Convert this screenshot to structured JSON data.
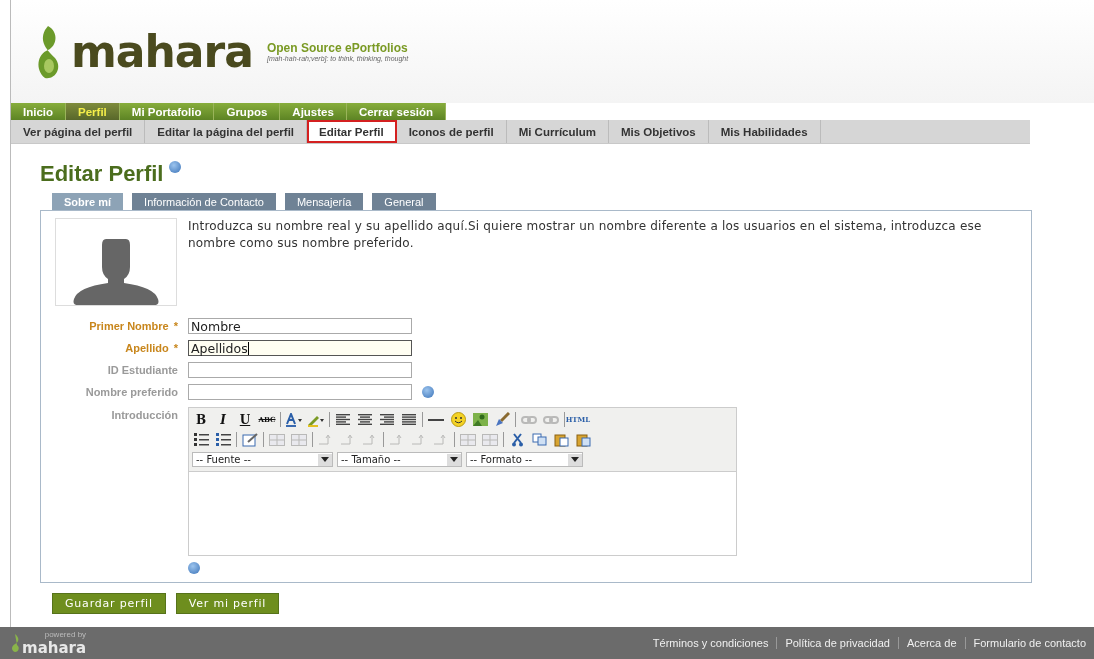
{
  "header": {
    "logo_text": "mahara",
    "tagline": "Open Source ePortfolios",
    "subtitle": "[mah-hah-rah;verb]: to think, thinking, thought"
  },
  "main_nav": [
    {
      "label": "Inicio",
      "selected": false
    },
    {
      "label": "Perfil",
      "selected": true
    },
    {
      "label": "Mi Portafolio",
      "selected": false
    },
    {
      "label": "Grupos",
      "selected": false
    },
    {
      "label": "Ajustes",
      "selected": false
    },
    {
      "label": "Cerrar sesión",
      "selected": false
    }
  ],
  "sub_nav": [
    {
      "label": "Ver página del perfil",
      "selected": false
    },
    {
      "label": "Editar la página del perfil",
      "selected": false
    },
    {
      "label": "Editar Perfil",
      "selected": true
    },
    {
      "label": "Iconos de perfil",
      "selected": false
    },
    {
      "label": "Mi Currículum",
      "selected": false
    },
    {
      "label": "Mis Objetivos",
      "selected": false
    },
    {
      "label": "Mis Habilidades",
      "selected": false
    }
  ],
  "page_title": "Editar Perfil",
  "tabs": [
    {
      "label": "Sobre mí",
      "selected": true
    },
    {
      "label": "Información de Contacto",
      "selected": false
    },
    {
      "label": "Mensajería",
      "selected": false
    },
    {
      "label": "General",
      "selected": false
    }
  ],
  "intro_text": "Introduzca su nombre real y su apellido aquí.Si quiere mostrar un nombre diferente a los usuarios en el sistema, introduzca ese nombre como sus nombre preferido.",
  "fields": [
    {
      "label": "Primer Nombre",
      "required": true,
      "mark": "*",
      "value": "Nombre",
      "focused": false,
      "help": false
    },
    {
      "label": "Apellido",
      "required": true,
      "mark": "*",
      "value": "Apellidos",
      "focused": true,
      "help": false
    },
    {
      "label": "ID Estudiante",
      "required": false,
      "focused": false,
      "help": false
    },
    {
      "label": "Nombre preferido",
      "required": false,
      "focused": false,
      "help": true
    }
  ],
  "editor": {
    "label": "Introducción",
    "toolbar_rows": [
      [
        {
          "kind": "bold",
          "label": "B",
          "disabled": false
        },
        {
          "kind": "italic",
          "label": "I",
          "disabled": false
        },
        {
          "kind": "underline",
          "label": "U",
          "disabled": false
        },
        {
          "kind": "strike",
          "label": "ABC",
          "disabled": false
        },
        {
          "kind": "sep"
        },
        {
          "kind": "fontcolor",
          "disabled": false
        },
        {
          "kind": "highlight",
          "disabled": false
        },
        {
          "kind": "sep"
        },
        {
          "kind": "alignleft",
          "disabled": false
        },
        {
          "kind": "aligncenter",
          "disabled": false
        },
        {
          "kind": "alignright",
          "disabled": false
        },
        {
          "kind": "justify",
          "disabled": false
        },
        {
          "kind": "sep"
        },
        {
          "kind": "hr",
          "disabled": false
        },
        {
          "kind": "smiley",
          "disabled": false
        },
        {
          "kind": "image",
          "disabled": false
        },
        {
          "kind": "brush",
          "disabled": false
        },
        {
          "kind": "sep"
        },
        {
          "kind": "link",
          "disabled": true
        },
        {
          "kind": "unlink",
          "disabled": true
        },
        {
          "kind": "sep"
        },
        {
          "kind": "html",
          "label": "HTML",
          "disabled": false
        }
      ],
      [
        {
          "kind": "bullist",
          "disabled": false
        },
        {
          "kind": "numlist",
          "disabled": false
        },
        {
          "kind": "sep"
        },
        {
          "kind": "edit",
          "disabled": false
        },
        {
          "kind": "sep"
        },
        {
          "kind": "table",
          "disabled": true
        },
        {
          "kind": "table",
          "disabled": true
        },
        {
          "kind": "sep"
        },
        {
          "kind": "arrows",
          "disabled": true
        },
        {
          "kind": "arrows",
          "disabled": true
        },
        {
          "kind": "arrows",
          "disabled": true
        },
        {
          "kind": "sep"
        },
        {
          "kind": "arrows",
          "disabled": true
        },
        {
          "kind": "arrows",
          "disabled": true
        },
        {
          "kind": "arrows",
          "disabled": true
        },
        {
          "kind": "sep"
        },
        {
          "kind": "table",
          "disabled": true
        },
        {
          "kind": "table",
          "disabled": true
        },
        {
          "kind": "sep"
        },
        {
          "kind": "cut",
          "disabled": false
        },
        {
          "kind": "copy",
          "disabled": false
        },
        {
          "kind": "paste",
          "disabled": false
        },
        {
          "kind": "pasteword",
          "disabled": false
        }
      ]
    ],
    "selects": [
      "-- Fuente --",
      "-- Tamaño --",
      "-- Formato --"
    ]
  },
  "buttons": [
    "Guardar perfil",
    "Ver mi perfil"
  ],
  "footer": {
    "powered_by": "powered by",
    "logo_text": "mahara",
    "links": [
      "Términos y condiciones",
      "Política de privacidad",
      "Acerca de",
      "Formulario de contacto"
    ]
  }
}
